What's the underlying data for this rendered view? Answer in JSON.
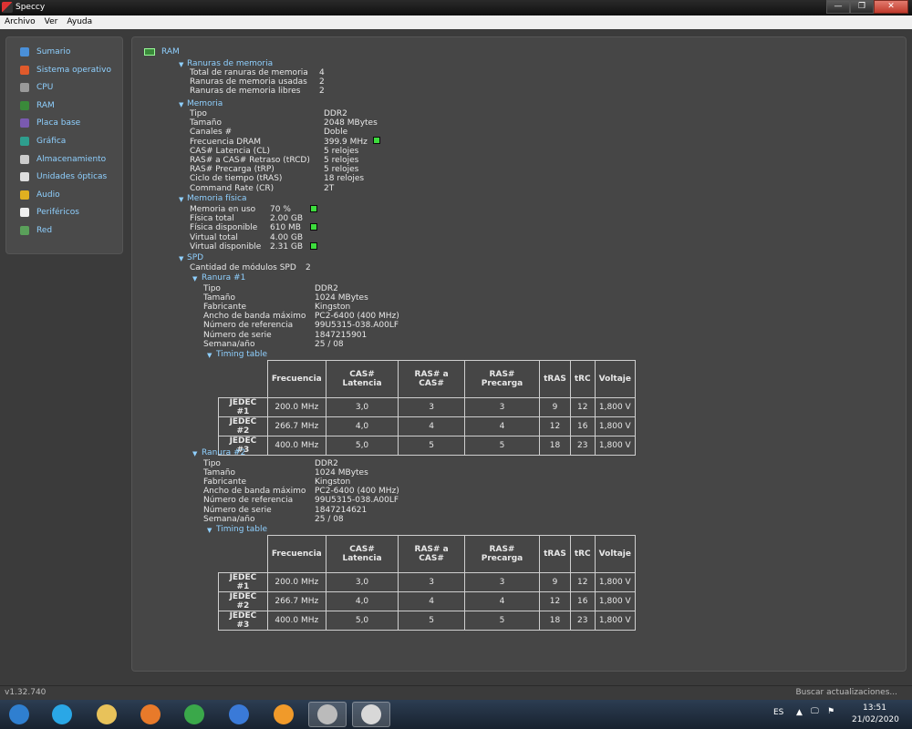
{
  "window": {
    "title": "Speccy",
    "controls": [
      "—",
      "❐",
      "✕"
    ]
  },
  "menu": [
    "Archivo",
    "Ver",
    "Ayuda"
  ],
  "sidebar": [
    {
      "label": "Sumario",
      "color": "#4a90d9"
    },
    {
      "label": "Sistema operativo",
      "color": "#e05a2b"
    },
    {
      "label": "CPU",
      "color": "#9a9a9a"
    },
    {
      "label": "RAM",
      "color": "#3a8a3a"
    },
    {
      "label": "Placa base",
      "color": "#7a5ab0"
    },
    {
      "label": "Gráfica",
      "color": "#2e9e8e"
    },
    {
      "label": "Almacenamiento",
      "color": "#cccccc"
    },
    {
      "label": "Unidades ópticas",
      "color": "#dddddd"
    },
    {
      "label": "Audio",
      "color": "#e0b020"
    },
    {
      "label": "Periféricos",
      "color": "#eeeeee"
    },
    {
      "label": "Red",
      "color": "#5aa05a"
    }
  ],
  "ram": {
    "title": "RAM",
    "slots": {
      "header": "Ranuras de memoria",
      "rows": [
        {
          "label": "Total de ranuras de memoria",
          "value": "4"
        },
        {
          "label": "Ranuras de memoria usadas",
          "value": "2"
        },
        {
          "label": "Ranuras de memoria libres",
          "value": "2"
        }
      ]
    },
    "memory": {
      "header": "Memoria",
      "rows": [
        {
          "label": "Tipo",
          "value": "DDR2"
        },
        {
          "label": "Tamaño",
          "value": "2048 MBytes"
        },
        {
          "label": "Canales #",
          "value": "Doble"
        },
        {
          "label": "Frecuencia DRAM",
          "value": "399.9 MHz"
        },
        {
          "label": "CAS# Latencia (CL)",
          "value": "5 relojes"
        },
        {
          "label": "RAS# a CAS# Retraso (tRCD)",
          "value": "5 relojes"
        },
        {
          "label": "RAS# Precarga (tRP)",
          "value": "5 relojes"
        },
        {
          "label": "Ciclo de tiempo (tRAS)",
          "value": "18 relojes"
        },
        {
          "label": "Command Rate (CR)",
          "value": "2T"
        }
      ]
    },
    "physical": {
      "header": "Memoria física",
      "rows": [
        {
          "label": "Memoria en uso",
          "value": "70 %"
        },
        {
          "label": "Física total",
          "value": "2.00 GB"
        },
        {
          "label": "Física disponible",
          "value": "610 MB"
        },
        {
          "label": "Virtual total",
          "value": "4.00 GB"
        },
        {
          "label": "Virtual disponible",
          "value": "2.31 GB"
        }
      ]
    },
    "spd": {
      "header": "SPD",
      "count_label": "Cantidad de módulos SPD",
      "count_value": "2",
      "timing_label": "Timing table",
      "table_headers": [
        "Frecuencia",
        "CAS# Latencia",
        "RAS# a CAS#",
        "RAS# Precarga",
        "tRAS",
        "tRC",
        "Voltaje"
      ],
      "slots": [
        {
          "header": "Ranura #1",
          "rows": [
            {
              "label": "Tipo",
              "value": "DDR2"
            },
            {
              "label": "Tamaño",
              "value": "1024 MBytes"
            },
            {
              "label": "Fabricante",
              "value": "Kingston"
            },
            {
              "label": "Ancho de banda máximo",
              "value": "PC2-6400 (400 MHz)"
            },
            {
              "label": "Número de referencia",
              "value": "99U5315-038.A00LF"
            },
            {
              "label": "Número de serie",
              "value": "1847215901"
            },
            {
              "label": "Semana/año",
              "value": "25 / 08"
            }
          ],
          "timing": [
            [
              "JEDEC #1",
              "200.0 MHz",
              "3,0",
              "3",
              "3",
              "9",
              "12",
              "1,800 V"
            ],
            [
              "JEDEC #2",
              "266.7 MHz",
              "4,0",
              "4",
              "4",
              "12",
              "16",
              "1,800 V"
            ],
            [
              "JEDEC #3",
              "400.0 MHz",
              "5,0",
              "5",
              "5",
              "18",
              "23",
              "1,800 V"
            ]
          ]
        },
        {
          "header": "Ranura #2",
          "rows": [
            {
              "label": "Tipo",
              "value": "DDR2"
            },
            {
              "label": "Tamaño",
              "value": "1024 MBytes"
            },
            {
              "label": "Fabricante",
              "value": "Kingston"
            },
            {
              "label": "Ancho de banda máximo",
              "value": "PC2-6400 (400 MHz)"
            },
            {
              "label": "Número de referencia",
              "value": "99U5315-038.A00LF"
            },
            {
              "label": "Número de serie",
              "value": "1847214621"
            },
            {
              "label": "Semana/año",
              "value": "25 / 08"
            }
          ],
          "timing": [
            [
              "JEDEC #1",
              "200.0 MHz",
              "3,0",
              "3",
              "3",
              "9",
              "12",
              "1,800 V"
            ],
            [
              "JEDEC #2",
              "266.7 MHz",
              "4,0",
              "4",
              "4",
              "12",
              "16",
              "1,800 V"
            ],
            [
              "JEDEC #3",
              "400.0 MHz",
              "5,0",
              "5",
              "5",
              "18",
              "23",
              "1,800 V"
            ]
          ]
        }
      ]
    }
  },
  "status": {
    "version": "v1.32.740",
    "update": "Buscar actualizaciones..."
  },
  "taskbar": {
    "apps": [
      {
        "name": "start-orb-icon",
        "color": "#2f7fd0"
      },
      {
        "name": "internet-explorer-icon",
        "color": "#2aa7e6"
      },
      {
        "name": "file-explorer-icon",
        "color": "#e8c25a"
      },
      {
        "name": "media-player-icon",
        "color": "#e87a2a"
      },
      {
        "name": "chrome-icon",
        "color": "#3aa84a"
      },
      {
        "name": "chromium-icon",
        "color": "#3a7ad8"
      },
      {
        "name": "settings-app-icon",
        "color": "#f09a2a"
      },
      {
        "name": "speccy-icon",
        "color": "#bbbbbb"
      },
      {
        "name": "paint-icon",
        "color": "#d8d8d8"
      }
    ],
    "lang": "ES",
    "time": "13:51",
    "date": "21/02/2020"
  }
}
